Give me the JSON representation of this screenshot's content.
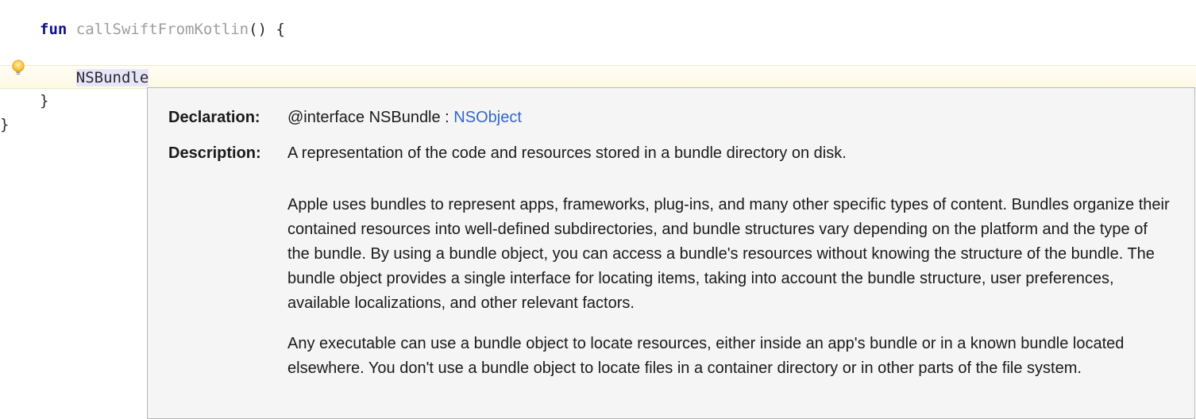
{
  "code": {
    "fun_keyword": "fun",
    "fn_name": "callSwiftFromKotlin",
    "open_paren": "()",
    "space_brace": " {",
    "identifier": "NSBundle",
    "close_brace_inner": "}",
    "close_brace_outer": "}"
  },
  "doc": {
    "declaration_label": "Declaration:",
    "declaration_prefix": "@interface NSBundle : ",
    "declaration_link": "NSObject",
    "description_label": "Description:",
    "description_summary": "A representation of the code and resources stored in a bundle directory on disk.",
    "description_p1": "Apple uses bundles to represent apps, frameworks, plug-ins, and many other specific types of content. Bundles organize their contained resources into well-defined subdirectories, and bundle structures vary depending on the platform and the type of the bundle. By using a bundle object, you can access a bundle's resources without knowing the structure of the bundle. The bundle object provides a single interface for locating items, taking into account the bundle structure, user preferences, available localizations, and other relevant factors.",
    "description_p2": "Any executable can use a bundle object to locate resources, either inside an app's bundle or in a known bundle located elsewhere. You don't use a bundle object to locate files in a container directory or in other parts of the file system."
  }
}
